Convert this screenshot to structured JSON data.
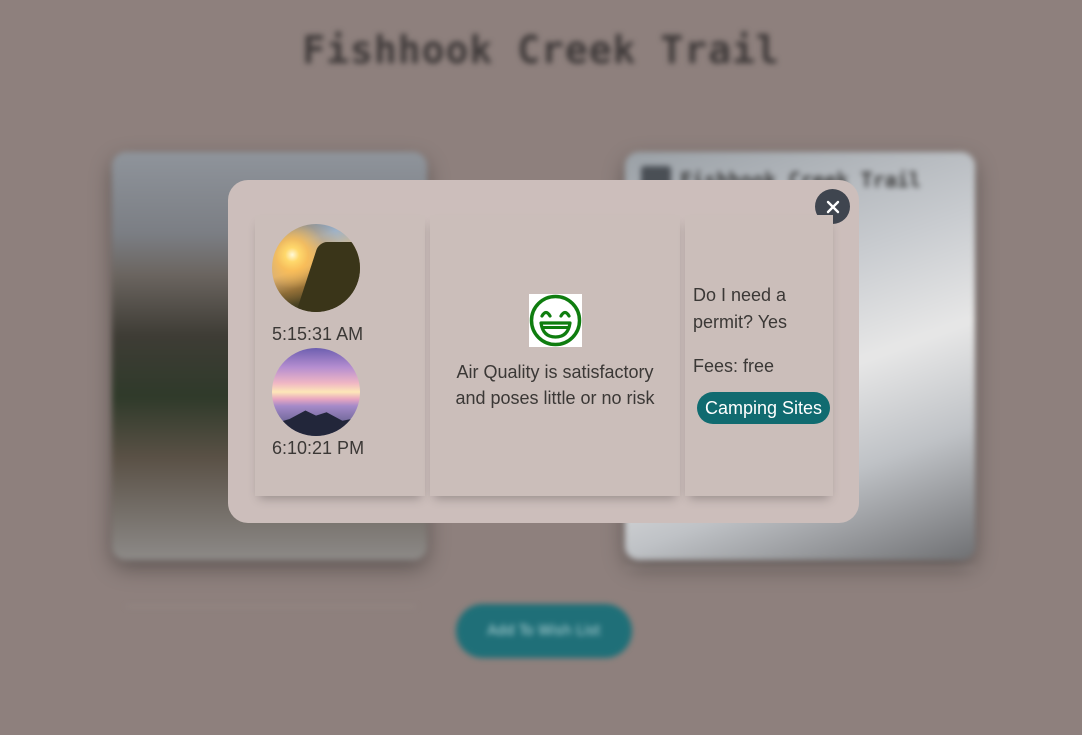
{
  "background": {
    "title": "Fishhook Creek Trail",
    "card_right_label": "Fishhook Creek Trail",
    "wish_button": "Add To Wish List"
  },
  "modal": {
    "close_icon": "close-icon",
    "sunrise": {
      "time": "5:15:31 AM"
    },
    "sunset": {
      "time": "6:10:21 PM"
    },
    "air_quality": {
      "icon": "grinning-face-icon",
      "icon_color": "#0f7d0f",
      "text": "Air Quality is satisfactory and poses little or no risk"
    },
    "info": {
      "permit": "Do I need a permit? Yes",
      "fees": "Fees: free",
      "camping_button": "Camping Sites",
      "camping_button_color": "#106b70"
    }
  }
}
